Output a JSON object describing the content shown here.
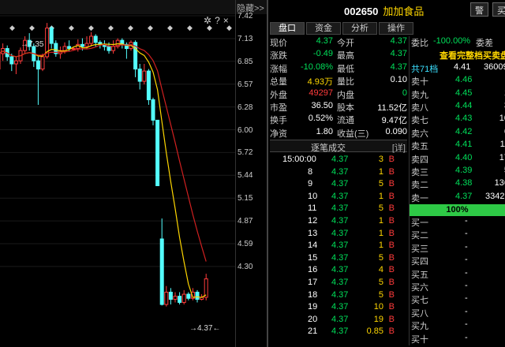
{
  "chart": {
    "hide_label": "隐藏>>",
    "settings_icon": "gear-icon",
    "help_label": "?",
    "close_label": "×",
    "y_labels": [
      "7.42",
      "7.13",
      "6.85",
      "6.57",
      "6.28",
      "6.00",
      "5.72",
      "5.44",
      "5.15",
      "4.87",
      "4.59",
      "4.30"
    ],
    "high_annot": "→7.35",
    "low_annot": "→4.37←",
    "candles": [
      {
        "o": 6.9,
        "c": 7.05,
        "h": 7.08,
        "l": 6.85
      },
      {
        "o": 7.05,
        "c": 7.1,
        "h": 7.15,
        "l": 6.98
      },
      {
        "o": 7.1,
        "c": 7.02,
        "h": 7.13,
        "l": 6.98
      },
      {
        "o": 7.02,
        "c": 6.95,
        "h": 7.05,
        "l": 6.88
      },
      {
        "o": 6.95,
        "c": 6.98,
        "h": 7.02,
        "l": 6.85
      },
      {
        "o": 6.98,
        "c": 7.08,
        "h": 7.11,
        "l": 6.95
      },
      {
        "o": 7.08,
        "c": 7.18,
        "h": 7.22,
        "l": 7.05
      },
      {
        "o": 7.18,
        "c": 7.12,
        "h": 7.25,
        "l": 7.08
      },
      {
        "o": 7.12,
        "c": 6.98,
        "h": 7.15,
        "l": 6.92
      },
      {
        "o": 6.98,
        "c": 6.9,
        "h": 7.02,
        "l": 6.55
      },
      {
        "o": 6.9,
        "c": 7.02,
        "h": 7.05,
        "l": 6.88
      },
      {
        "o": 7.02,
        "c": 7.3,
        "h": 7.35,
        "l": 7.0
      },
      {
        "o": 7.3,
        "c": 7.15,
        "h": 7.32,
        "l": 7.1
      },
      {
        "o": 7.15,
        "c": 7.05,
        "h": 7.18,
        "l": 7.02
      },
      {
        "o": 7.05,
        "c": 7.08,
        "h": 7.12,
        "l": 7.0
      },
      {
        "o": 7.08,
        "c": 7.12,
        "h": 7.16,
        "l": 7.05
      },
      {
        "o": 7.12,
        "c": 7.1,
        "h": 7.18,
        "l": 7.07
      },
      {
        "o": 7.1,
        "c": 7.1,
        "h": 7.12,
        "l": 7.08
      },
      {
        "o": 7.1,
        "c": 7.14,
        "h": 7.19,
        "l": 7.07
      },
      {
        "o": 7.14,
        "c": 7.12,
        "h": 7.2,
        "l": 7.08
      },
      {
        "o": 7.12,
        "c": 7.15,
        "h": 7.22,
        "l": 7.1
      },
      {
        "o": 7.15,
        "c": 7.22,
        "h": 7.26,
        "l": 7.12
      },
      {
        "o": 7.22,
        "c": 7.16,
        "h": 7.24,
        "l": 7.12
      },
      {
        "o": 7.16,
        "c": 7.14,
        "h": 7.18,
        "l": 7.1
      },
      {
        "o": 7.14,
        "c": 7.12,
        "h": 7.18,
        "l": 7.08
      },
      {
        "o": 7.12,
        "c": 7.08,
        "h": 7.16,
        "l": 7.05
      },
      {
        "o": 7.08,
        "c": 7.12,
        "h": 7.18,
        "l": 7.05
      },
      {
        "o": 7.12,
        "c": 7.18,
        "h": 7.2,
        "l": 7.1
      },
      {
        "o": 7.18,
        "c": 7.14,
        "h": 7.2,
        "l": 7.1
      },
      {
        "o": 7.14,
        "c": 7.1,
        "h": 7.16,
        "l": 7.0
      },
      {
        "o": 7.1,
        "c": 7.16,
        "h": 7.18,
        "l": 7.08
      },
      {
        "o": 7.16,
        "c": 6.9,
        "h": 7.18,
        "l": 6.82
      },
      {
        "o": 6.9,
        "c": 6.78,
        "h": 6.95,
        "l": 6.7
      },
      {
        "o": 6.78,
        "c": 6.88,
        "h": 6.95,
        "l": 6.75
      },
      {
        "o": 6.88,
        "c": 6.6,
        "h": 6.9,
        "l": 6.55
      },
      {
        "o": 6.6,
        "c": 6.4,
        "h": 6.62,
        "l": 6.35
      },
      {
        "o": 6.4,
        "c": 5.76,
        "h": 6.4,
        "l": 5.76
      },
      {
        "o": 5.24,
        "c": 4.6,
        "h": 5.44,
        "l": 4.59
      },
      {
        "o": 4.6,
        "c": 4.72,
        "h": 4.78,
        "l": 4.58
      },
      {
        "o": 4.72,
        "c": 4.65,
        "h": 4.76,
        "l": 4.6
      },
      {
        "o": 4.65,
        "c": 4.68,
        "h": 4.72,
        "l": 4.62
      },
      {
        "o": 4.68,
        "c": 4.62,
        "h": 4.72,
        "l": 4.6
      },
      {
        "o": 4.62,
        "c": 4.7,
        "h": 4.74,
        "l": 4.6
      },
      {
        "o": 4.7,
        "c": 4.66,
        "h": 4.72,
        "l": 4.64
      },
      {
        "o": 4.66,
        "c": 4.72,
        "h": 4.76,
        "l": 4.64
      },
      {
        "o": 4.72,
        "c": 4.65,
        "h": 4.74,
        "l": 4.62
      },
      {
        "o": 4.65,
        "c": 4.67,
        "h": 4.7,
        "l": 4.64
      },
      {
        "o": 4.67,
        "c": 4.85,
        "h": 4.9,
        "l": 4.64
      }
    ]
  },
  "header": {
    "code": "002650",
    "name": "加加食品",
    "btn_alert": "警",
    "btn_buy": "买"
  },
  "tabs": [
    "盘口",
    "资金",
    "分析",
    "操作"
  ],
  "quote": [
    {
      "k1": "现价",
      "v1": "4.37",
      "k2": "今开",
      "v2": "4.37",
      "c1": "green",
      "c2": "green"
    },
    {
      "k1": "涨跌",
      "v1": "-0.49",
      "k2": "最高",
      "v2": "4.37",
      "c1": "green",
      "c2": "green"
    },
    {
      "k1": "涨幅",
      "v1": "-10.08%",
      "k2": "最低",
      "v2": "4.37",
      "c1": "green",
      "c2": "green"
    },
    {
      "k1": "总量",
      "v1": "4.93万",
      "k2": "量比",
      "v2": "0.10",
      "c1": "yellow",
      "c2": "white"
    },
    {
      "k1": "外盘",
      "v1": "49297",
      "k2": "内盘",
      "v2": "0",
      "c1": "red",
      "c2": "green"
    },
    {
      "k1": "市盈",
      "v1": "36.50",
      "k2": "股本",
      "v2": "11.52亿",
      "c1": "white",
      "c2": "white"
    },
    {
      "k1": "换手",
      "v1": "0.52%",
      "k2": "流通",
      "v2": "9.47亿",
      "c1": "white",
      "c2": "white"
    },
    {
      "k1": "净资",
      "v1": "1.80",
      "k2": "收益(三)",
      "v2": "0.090",
      "c1": "white",
      "c2": "white"
    }
  ],
  "trades_header": {
    "title": "逐笔成交",
    "detail": "[详]"
  },
  "trades": [
    {
      "time": "15:00:00",
      "price": "4.37",
      "vol": "3",
      "side": "B"
    },
    {
      "time": "8",
      "price": "4.37",
      "vol": "1",
      "side": "B"
    },
    {
      "time": "9",
      "price": "4.37",
      "vol": "5",
      "side": "B"
    },
    {
      "time": "10",
      "price": "4.37",
      "vol": "1",
      "side": "B"
    },
    {
      "time": "11",
      "price": "4.37",
      "vol": "5",
      "side": "B"
    },
    {
      "time": "12",
      "price": "4.37",
      "vol": "1",
      "side": "B"
    },
    {
      "time": "13",
      "price": "4.37",
      "vol": "1",
      "side": "B"
    },
    {
      "time": "14",
      "price": "4.37",
      "vol": "1",
      "side": "B"
    },
    {
      "time": "15",
      "price": "4.37",
      "vol": "5",
      "side": "B"
    },
    {
      "time": "16",
      "price": "4.37",
      "vol": "4",
      "side": "B"
    },
    {
      "time": "17",
      "price": "4.37",
      "vol": "5",
      "side": "B"
    },
    {
      "time": "18",
      "price": "4.37",
      "vol": "5",
      "side": "B"
    },
    {
      "time": "19",
      "price": "4.37",
      "vol": "10",
      "side": "B"
    },
    {
      "time": "20",
      "price": "4.37",
      "vol": "19",
      "side": "B"
    },
    {
      "time": "21",
      "price": "4.37",
      "vol": "0.85",
      "side": "B"
    }
  ],
  "orderbook": {
    "ratio_label": "委比",
    "ratio_value": "-100.00%",
    "diff_label": "委差",
    "link": "查看完整档买卖盘",
    "levels_label": "共71档",
    "levels_price": "4.41",
    "levels_vol": "36009",
    "asks": [
      {
        "name": "卖十",
        "price": "4.46",
        "vol": ""
      },
      {
        "name": "卖九",
        "price": "4.45",
        "vol": "1"
      },
      {
        "name": "卖八",
        "price": "4.44",
        "vol": "3"
      },
      {
        "name": "卖七",
        "price": "4.43",
        "vol": "10"
      },
      {
        "name": "卖六",
        "price": "4.42",
        "vol": "6"
      },
      {
        "name": "卖五",
        "price": "4.41",
        "vol": "11"
      },
      {
        "name": "卖四",
        "price": "4.40",
        "vol": "17"
      },
      {
        "name": "卖三",
        "price": "4.39",
        "vol": "5"
      },
      {
        "name": "卖二",
        "price": "4.38",
        "vol": "136"
      },
      {
        "name": "卖一",
        "price": "4.37",
        "vol": "33421"
      }
    ],
    "pct": "100%",
    "bids": [
      {
        "name": "买一",
        "price": "-"
      },
      {
        "name": "买二",
        "price": "-"
      },
      {
        "name": "买三",
        "price": "-"
      },
      {
        "name": "买四",
        "price": "-"
      },
      {
        "name": "买五",
        "price": "-"
      },
      {
        "name": "买六",
        "price": "-"
      },
      {
        "name": "买七",
        "price": "-"
      },
      {
        "name": "买八",
        "price": "-"
      },
      {
        "name": "买九",
        "price": "-"
      },
      {
        "name": "买十",
        "price": "-"
      }
    ],
    "footer": "共71档"
  }
}
